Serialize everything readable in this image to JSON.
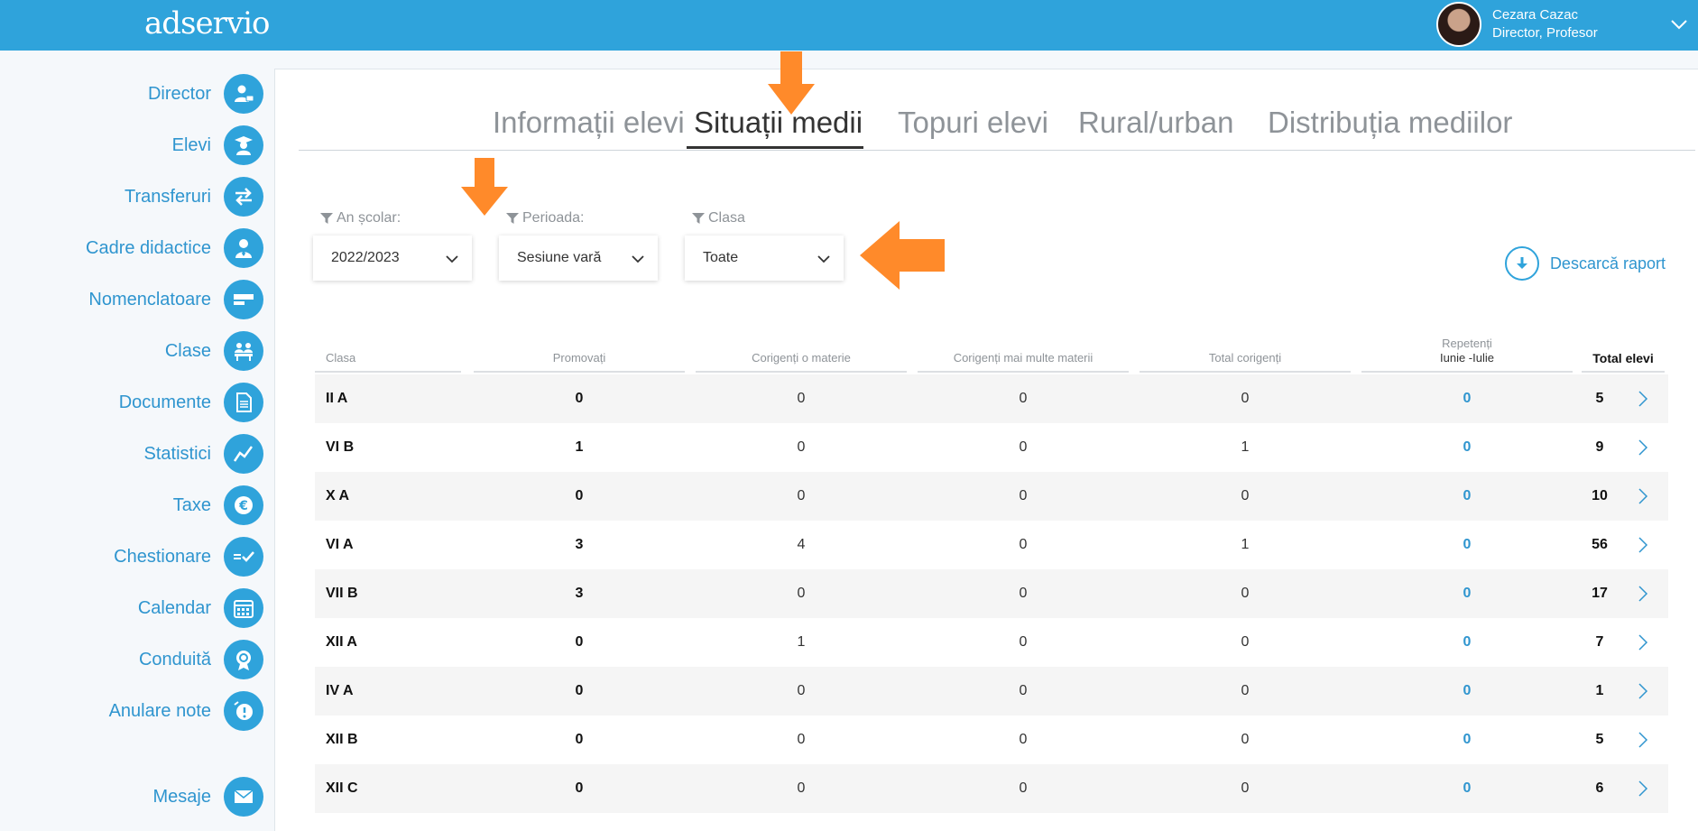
{
  "app": {
    "logo": "adservio"
  },
  "user": {
    "name": "Cezara Cazac",
    "role": "Director, Profesor"
  },
  "sidebar": {
    "items": [
      {
        "label": "Director",
        "icon": "director-icon"
      },
      {
        "label": "Elevi",
        "icon": "student-icon"
      },
      {
        "label": "Transferuri",
        "icon": "transfer-icon"
      },
      {
        "label": "Cadre didactice",
        "icon": "teacher-icon"
      },
      {
        "label": "Nomenclatoare",
        "icon": "card-icon"
      },
      {
        "label": "Clase",
        "icon": "classroom-icon"
      },
      {
        "label": "Documente",
        "icon": "document-icon"
      },
      {
        "label": "Statistici",
        "icon": "chart-icon"
      },
      {
        "label": "Taxe",
        "icon": "euro-icon"
      },
      {
        "label": "Chestionare",
        "icon": "survey-icon"
      },
      {
        "label": "Calendar",
        "icon": "calendar-icon"
      },
      {
        "label": "Conduită",
        "icon": "badge-icon"
      },
      {
        "label": "Anulare note",
        "icon": "cancel-grade-icon"
      }
    ],
    "messages": {
      "label": "Mesaje",
      "icon": "envelope-icon"
    }
  },
  "tabs": [
    {
      "label": "Informații elevi"
    },
    {
      "label": "Situații medii",
      "active": true
    },
    {
      "label": "Topuri elevi"
    },
    {
      "label": "Rural/urban"
    },
    {
      "label": "Distribuția mediilor"
    }
  ],
  "filters": {
    "year": {
      "label": "An școlar:",
      "value": "2022/2023"
    },
    "period": {
      "label": "Perioada:",
      "value": "Sesiune vară"
    },
    "class": {
      "label": "Clasa",
      "value": "Toate"
    }
  },
  "download": {
    "label": "Descarcă raport"
  },
  "table": {
    "headers": {
      "clasa": "Clasa",
      "promovati": "Promovați",
      "corigenti_o": "Corigenți o materie",
      "corigenti_multe": "Corigenți mai multe materii",
      "total_corigenti": "Total corigenți",
      "repetenti_1": "Repetenți",
      "repetenti_2": "Iunie -Iulie",
      "total": "Total elevi"
    },
    "rows": [
      {
        "clasa": "II A",
        "promovati": "0",
        "corigenti_o": "0",
        "corigenti_multe": "0",
        "total_corigenti": "0",
        "repetenti": "0",
        "total": "5"
      },
      {
        "clasa": "VI B",
        "promovati": "1",
        "corigenti_o": "0",
        "corigenti_multe": "0",
        "total_corigenti": "1",
        "repetenti": "0",
        "total": "9"
      },
      {
        "clasa": "X A",
        "promovati": "0",
        "corigenti_o": "0",
        "corigenti_multe": "0",
        "total_corigenti": "0",
        "repetenti": "0",
        "total": "10"
      },
      {
        "clasa": "VI A",
        "promovati": "3",
        "corigenti_o": "4",
        "corigenti_multe": "0",
        "total_corigenti": "1",
        "repetenti": "0",
        "total": "56"
      },
      {
        "clasa": "VII B",
        "promovati": "3",
        "corigenti_o": "0",
        "corigenti_multe": "0",
        "total_corigenti": "0",
        "repetenti": "0",
        "total": "17"
      },
      {
        "clasa": "XII A",
        "promovati": "0",
        "corigenti_o": "1",
        "corigenti_multe": "0",
        "total_corigenti": "0",
        "repetenti": "0",
        "total": "7"
      },
      {
        "clasa": "IV A",
        "promovati": "0",
        "corigenti_o": "0",
        "corigenti_multe": "0",
        "total_corigenti": "0",
        "repetenti": "0",
        "total": "1"
      },
      {
        "clasa": "XII B",
        "promovati": "0",
        "corigenti_o": "0",
        "corigenti_multe": "0",
        "total_corigenti": "0",
        "repetenti": "0",
        "total": "5"
      },
      {
        "clasa": "XII C",
        "promovati": "0",
        "corigenti_o": "0",
        "corigenti_multe": "0",
        "total_corigenti": "0",
        "repetenti": "0",
        "total": "6"
      }
    ]
  },
  "colors": {
    "brand": "#2fa3db",
    "link": "#2f95cf",
    "annotation_arrow": "#ff8a2a"
  }
}
